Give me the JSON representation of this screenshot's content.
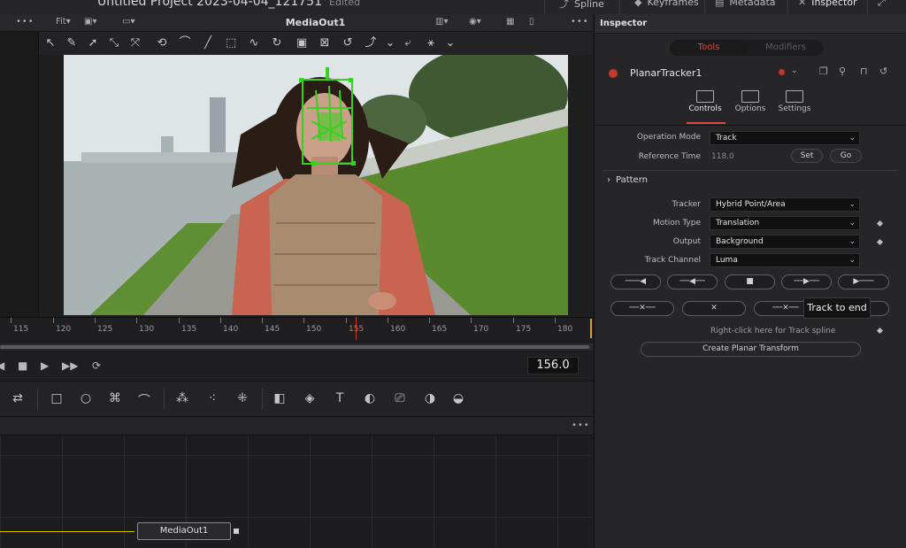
{
  "header": {
    "project_title": "Untitled Project 2023-04-04_121751",
    "edited": "Edited",
    "tabs": [
      {
        "label": "Spline",
        "icon": "spline-icon"
      },
      {
        "label": "Keyframes",
        "icon": "keyframes-icon"
      },
      {
        "label": "Metadata",
        "icon": "metadata-icon"
      },
      {
        "label": "Inspector",
        "icon": "inspector-icon"
      }
    ]
  },
  "viewer": {
    "fit_label": "Fit",
    "name": "MediaOut1",
    "more": "•••"
  },
  "timeline": {
    "ticks": [
      "115",
      "120",
      "125",
      "130",
      "135",
      "140",
      "145",
      "150",
      "155",
      "160",
      "165",
      "170",
      "175",
      "180"
    ],
    "current_frame": "156.0"
  },
  "node_editor": {
    "more": "•••",
    "node_label": "MediaOut1"
  },
  "inspector": {
    "title": "Inspector",
    "tabs": {
      "tools": "Tools",
      "modifiers": "Modifiers"
    },
    "node_name": "PlanarTracker1",
    "sub_tabs": {
      "controls": "Controls",
      "options": "Options",
      "settings": "Settings"
    },
    "operation_mode": {
      "label": "Operation Mode",
      "value": "Track"
    },
    "reference_time": {
      "label": "Reference Time",
      "value": "118.0",
      "set": "Set",
      "go": "Go"
    },
    "pattern": "Pattern",
    "tracker": {
      "label": "Tracker",
      "value": "Hybrid Point/Area"
    },
    "motion_type": {
      "label": "Motion Type",
      "value": "Translation"
    },
    "output": {
      "label": "Output",
      "value": "Background"
    },
    "track_channel": {
      "label": "Track Channel",
      "value": "Luma"
    },
    "tooltip": "Track to end",
    "spline_hint": "Right-click here for Track spline",
    "create_planar": "Create Planar Transform"
  },
  "colors": {
    "accent": "#e04848",
    "playhead": "#c0392b",
    "link": "#d8c400",
    "tracker_mesh": "#39d11f"
  }
}
